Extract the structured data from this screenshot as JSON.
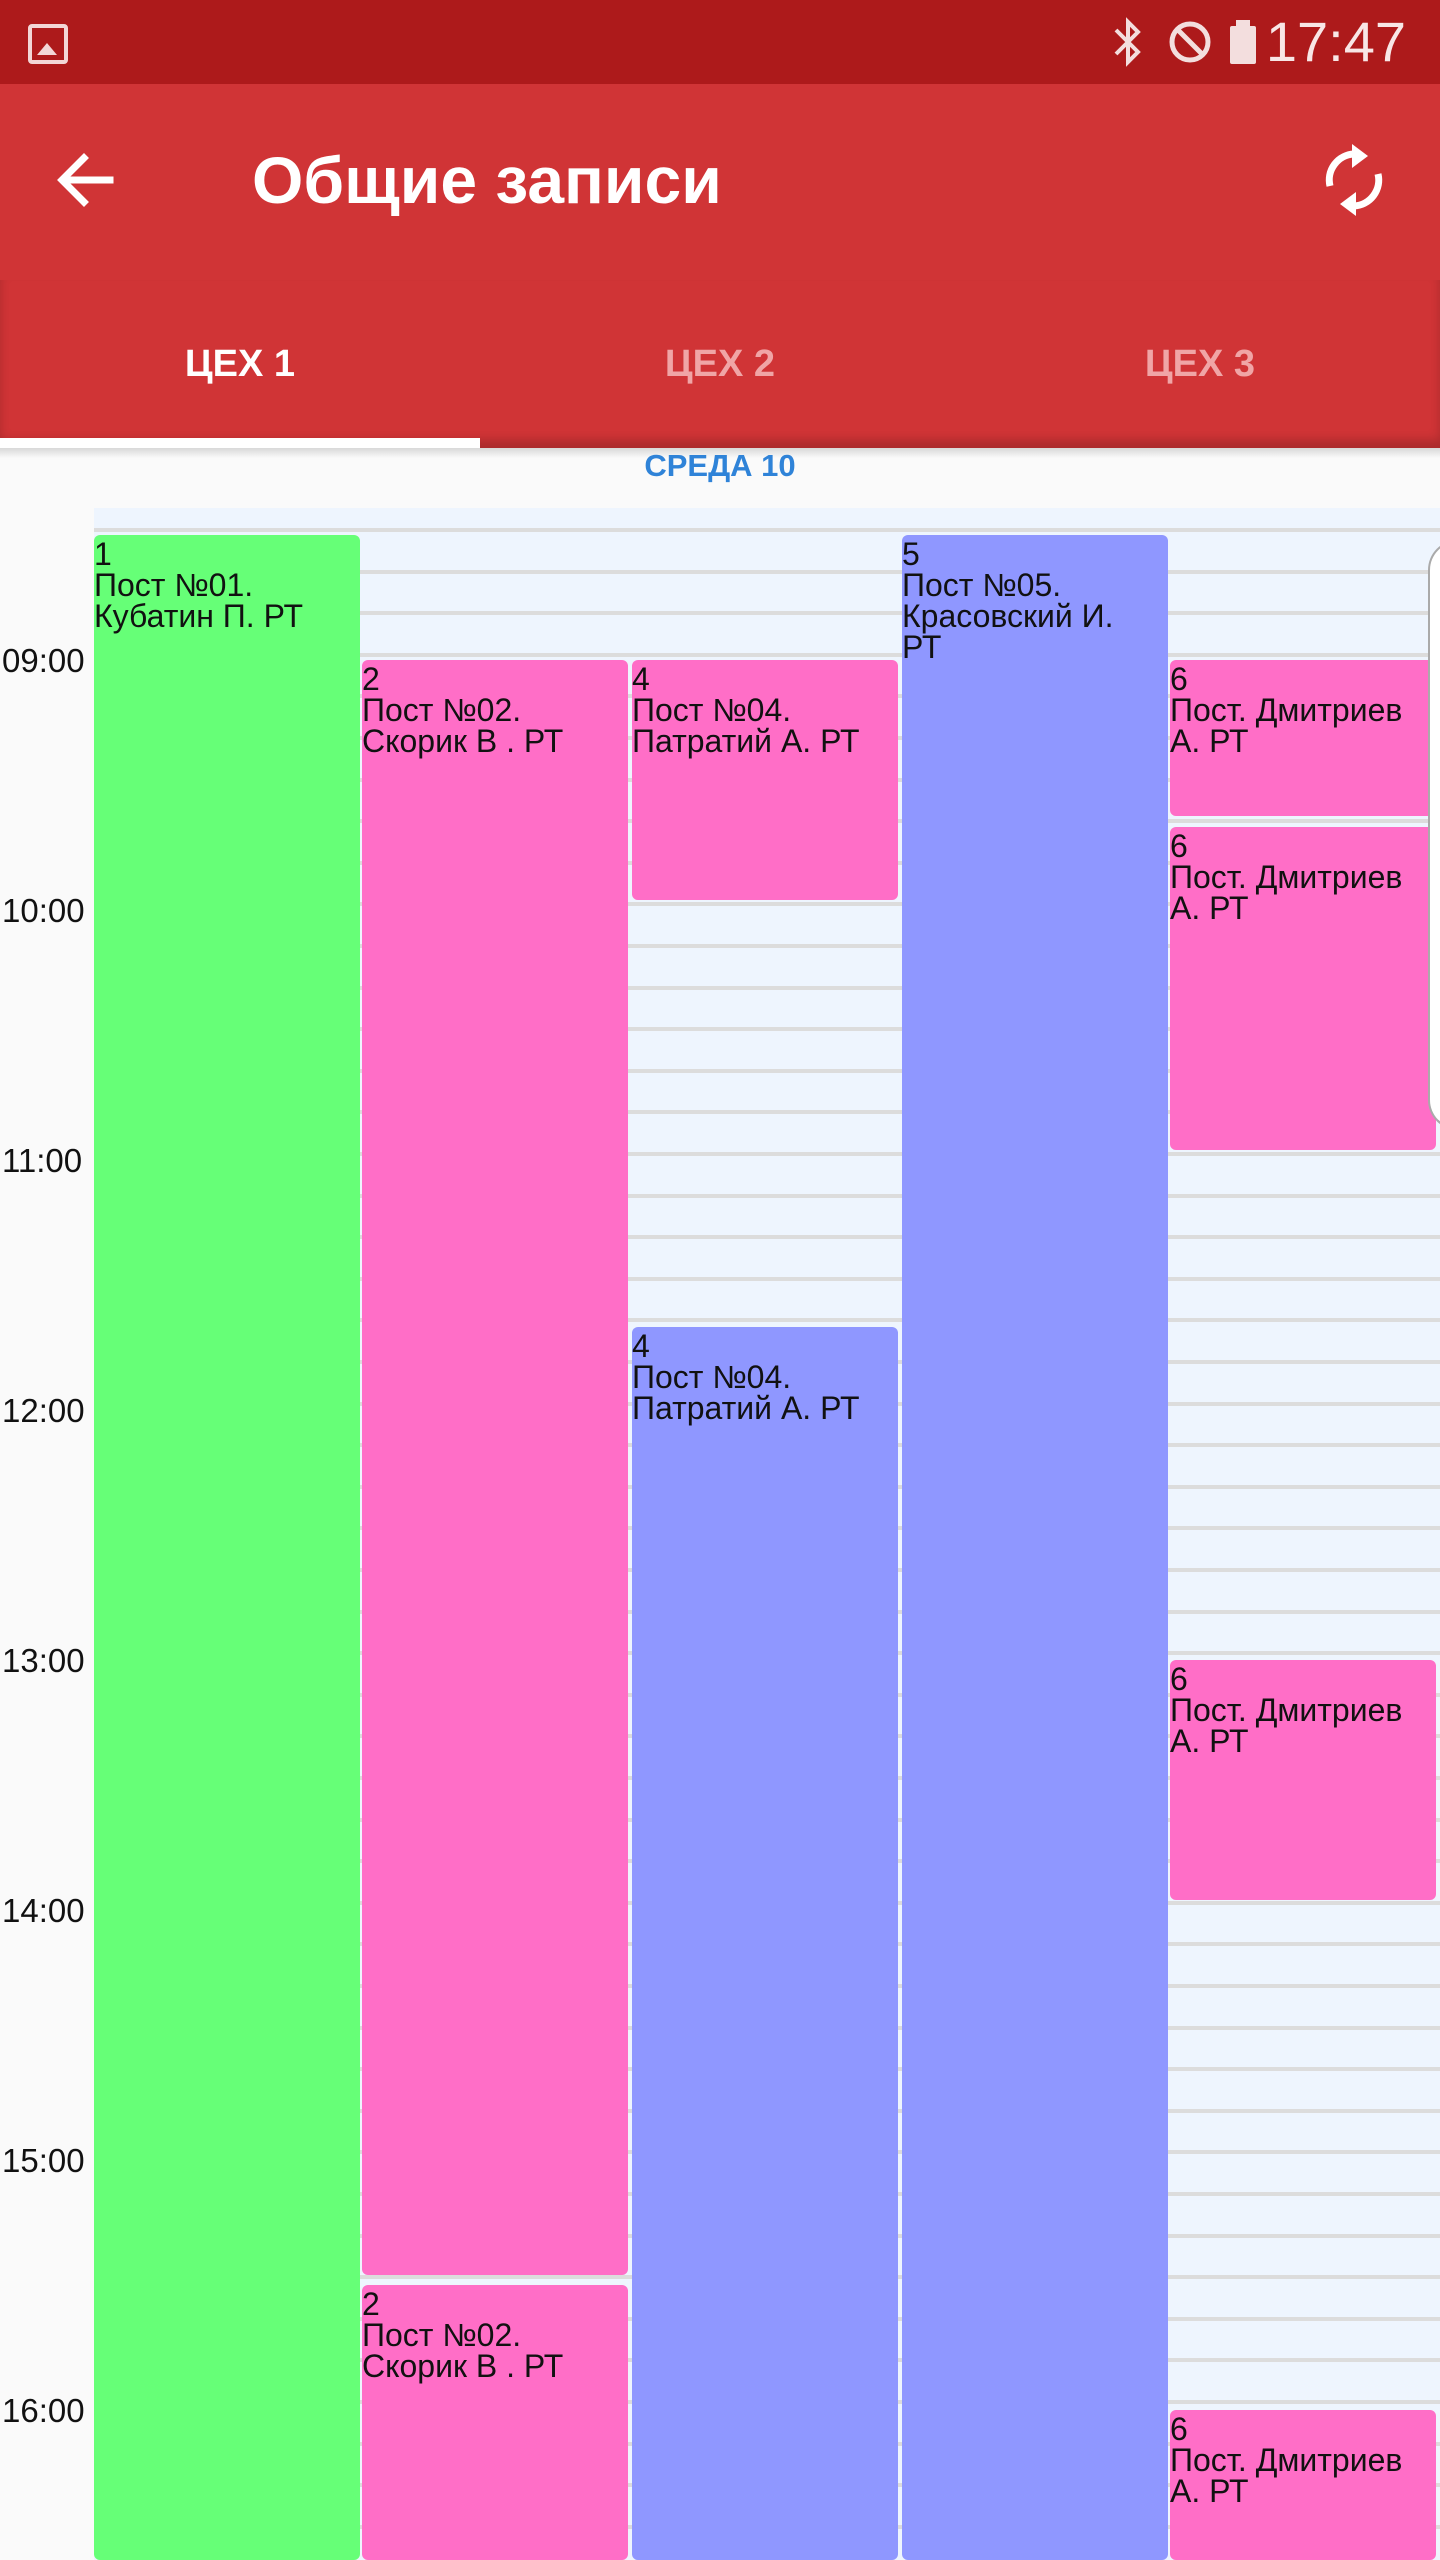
{
  "status_bar": {
    "time": "17:47",
    "icons": [
      "image-icon",
      "bluetooth-icon",
      "do-not-disturb-icon",
      "battery-icon"
    ]
  },
  "app_bar": {
    "title": "Общие записи",
    "back_icon": "arrow-back-icon",
    "refresh_icon": "refresh-icon"
  },
  "tabs": [
    {
      "label": "ЦЕХ 1",
      "active": true
    },
    {
      "label": "ЦЕХ 2",
      "active": false
    },
    {
      "label": "ЦЕХ 3",
      "active": false
    }
  ],
  "day_header": "СРЕДА 10",
  "time_labels": [
    "09:00",
    "10:00",
    "11:00",
    "12:00",
    "13:00",
    "14:00",
    "15:00",
    "16:00"
  ],
  "colors": {
    "primary": "#d03436",
    "status": "#ad1a1b",
    "green": "#66ff77",
    "pink": "#ff6ec7",
    "blue": "#8f97ff",
    "day_header": "#2f83d8"
  },
  "events": [
    {
      "col": 0,
      "start": "08:30",
      "color": "green",
      "num": "1",
      "post": "Пост №01.",
      "person": "Кубатин П.  РТ"
    },
    {
      "col": 1,
      "start": "09:00",
      "color": "pink",
      "num": "2",
      "post": "Пост №02.",
      "person": "Скорик В .  РТ"
    },
    {
      "col": 1,
      "start": "15:30",
      "color": "pink",
      "num": "2",
      "post": "Пост №02.",
      "person": "Скорик В .  РТ"
    },
    {
      "col": 2,
      "start": "09:00",
      "color": "pink",
      "num": "4",
      "post": "Пост №04.",
      "person": "Патратий А.  РТ"
    },
    {
      "col": 2,
      "start": "11:40",
      "color": "blue",
      "num": "4",
      "post": "Пост №04.",
      "person": "Патратий А.  РТ"
    },
    {
      "col": 3,
      "start": "08:30",
      "color": "blue",
      "num": "5",
      "post": "Пост №05.",
      "person": "Красовский И.\nРТ"
    },
    {
      "col": 4,
      "start": "09:00",
      "color": "pink",
      "num": "6",
      "post": "Пост. Дмитриев",
      "person": "А.  РТ"
    },
    {
      "col": 4,
      "start": "09:40",
      "color": "pink",
      "num": "6",
      "post": "Пост. Дмитриев",
      "person": "А.  РТ"
    },
    {
      "col": 4,
      "start": "13:00",
      "color": "pink",
      "num": "6",
      "post": "Пост. Дмитриев",
      "person": "А.  РТ"
    },
    {
      "col": 4,
      "start": "16:00",
      "color": "pink",
      "num": "6",
      "post": "Пост. Дмитриев",
      "person": "А.  РТ"
    }
  ]
}
